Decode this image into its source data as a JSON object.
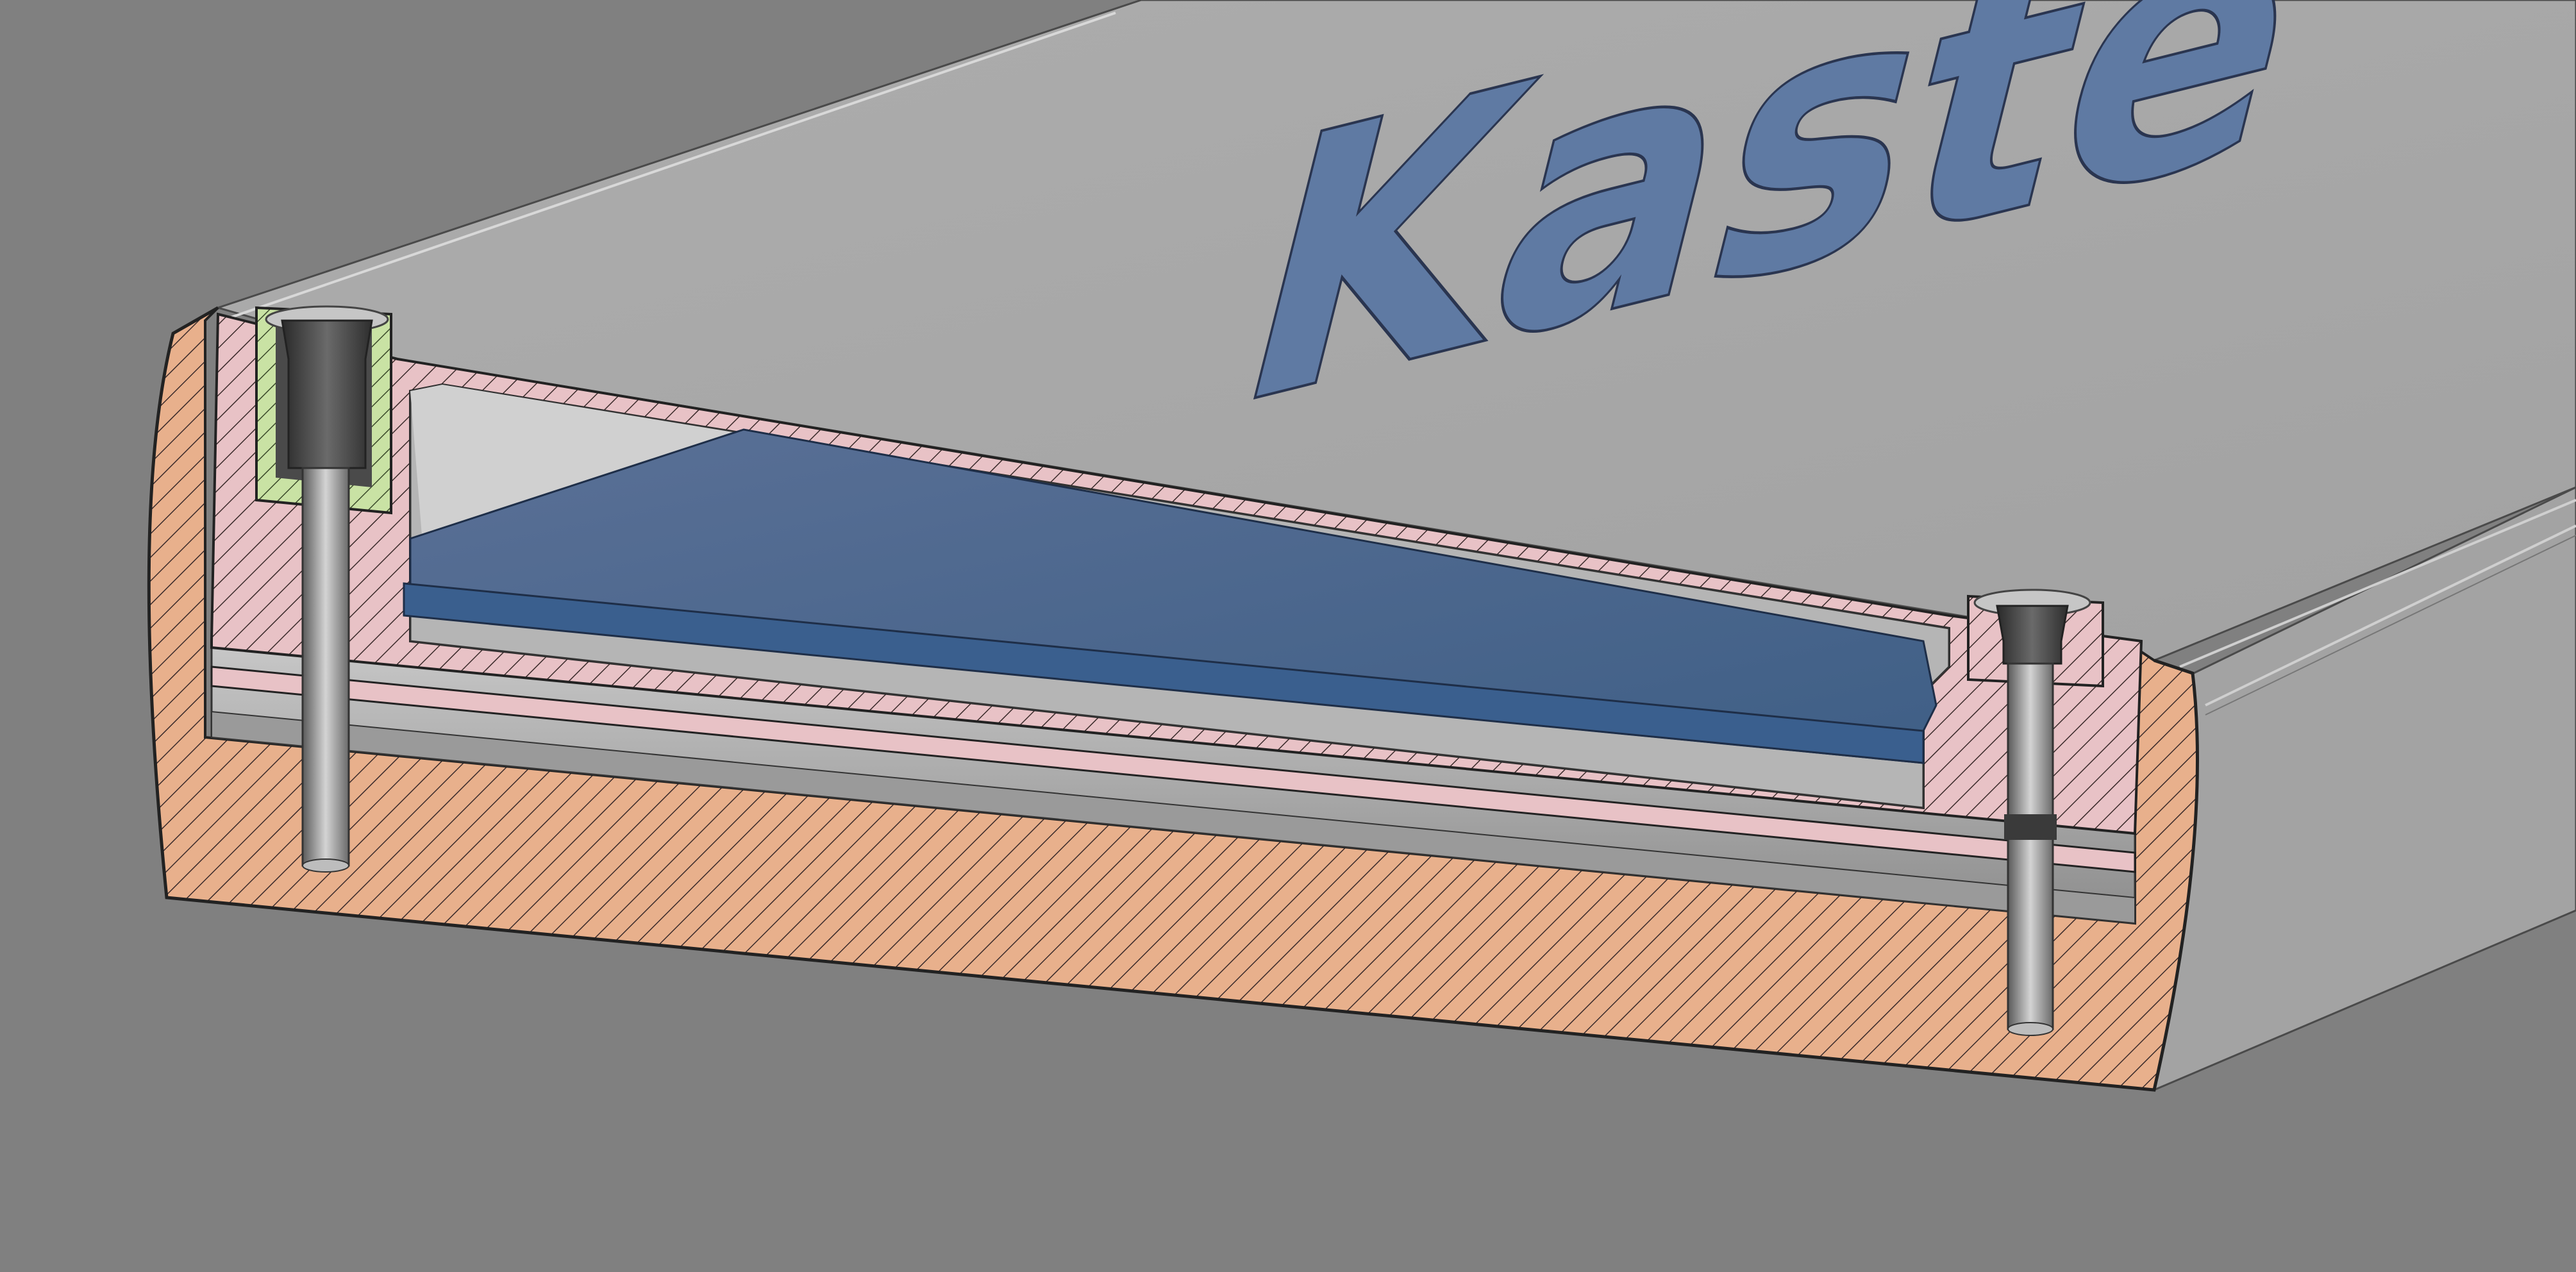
{
  "scene": {
    "engraved_text": "Kaste",
    "colors": {
      "background": "#808080",
      "enclosure_surface": "#a6a6a6",
      "outer_shell_section": "#e8b08c",
      "inner_tray_section": "#e8c2c6",
      "insert_section": "#c9e2a4",
      "panel": "#4e6f96",
      "engraving": "#5f7aa3",
      "hatch_line": "#3a2a2a"
    }
  }
}
